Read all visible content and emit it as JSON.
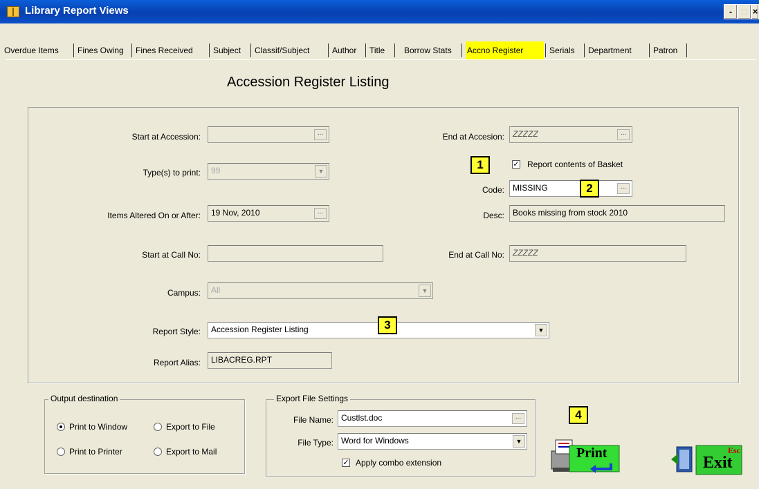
{
  "window": {
    "title": "Library Report Views",
    "controls": [
      "-",
      "□",
      "×"
    ]
  },
  "tabs": [
    {
      "label": "Overdue Items",
      "active": false
    },
    {
      "label": "Fines Owing",
      "active": false
    },
    {
      "label": "Fines Received",
      "active": false
    },
    {
      "label": "Subject",
      "active": false
    },
    {
      "label": "Classif/Subject",
      "active": false
    },
    {
      "label": "Author",
      "active": false
    },
    {
      "label": "Title",
      "active": false
    },
    {
      "label": "Borrow Stats",
      "active": false
    },
    {
      "label": "Accno Register",
      "active": true
    },
    {
      "label": "Serials",
      "active": false
    },
    {
      "label": "Department",
      "active": false
    },
    {
      "label": "Patron",
      "active": false
    }
  ],
  "heading": "Accession Register Listing",
  "form": {
    "start_accession_label": "Start at Accession:",
    "start_accession_value": "",
    "end_accession_label": "End at Accesion:",
    "end_accession_value": "ZZZZZ",
    "types_label": "Type(s) to print:",
    "types_value": "99",
    "report_basket_label": "Report contents of Basket",
    "report_basket_checked": true,
    "code_label": "Code:",
    "code_value": "MISSING",
    "altered_label": "Items Altered On or After:",
    "altered_value": "19 Nov, 2010",
    "desc_label": "Desc:",
    "desc_value": "Books missing from stock 2010",
    "start_call_label": "Start at Call No:",
    "start_call_value": "",
    "end_call_label": "End at Call No:",
    "end_call_value": "ZZZZZ",
    "campus_label": "Campus:",
    "campus_value": "All",
    "style_label": "Report Style:",
    "style_value": "Accession Register Listing",
    "alias_label": "Report Alias:",
    "alias_value": "LIBACREG.RPT",
    "ellipsis": "..."
  },
  "callouts": [
    "1",
    "2",
    "3",
    "4"
  ],
  "output_destination": {
    "title": "Output destination",
    "options": [
      "Print to Window",
      "Export to File",
      "Print to Printer",
      "Export to Mail"
    ],
    "selected": "Print to Window"
  },
  "export_settings": {
    "title": "Export  File Settings",
    "file_name_label": "File Name:",
    "file_name_value": "Custlst.doc",
    "file_type_label": "File Type:",
    "file_type_value": "Word for Windows",
    "apply_label": "Apply combo extension",
    "apply_checked": true
  },
  "buttons": {
    "print_label": "Print",
    "exit_label": "Exit",
    "exit_hotkey": "Esc"
  },
  "colors": {
    "titlebar": "#0a50c8",
    "active_tab": "#ffff00",
    "callout": "#ffff33",
    "window_bg": "#ece9d8"
  }
}
